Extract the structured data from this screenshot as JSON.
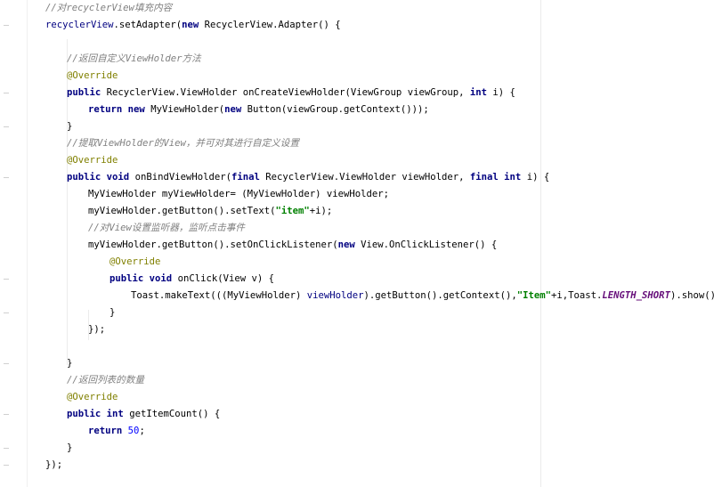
{
  "editor": {
    "lines": [
      {
        "indent": 0,
        "tokens": [
          {
            "t": "cm",
            "v": "//对recyclerView填充内容"
          }
        ]
      },
      {
        "indent": 0,
        "tokens": [
          {
            "t": "var",
            "v": "recyclerView"
          },
          {
            "t": "pl",
            "v": ".setAdapter("
          },
          {
            "t": "kw",
            "v": "new"
          },
          {
            "t": "pl",
            "v": " RecyclerView.Adapter() {"
          }
        ]
      },
      {
        "indent": 0,
        "tokens": []
      },
      {
        "indent": 1,
        "tokens": [
          {
            "t": "cm",
            "v": "//返回自定义ViewHolder方法"
          }
        ]
      },
      {
        "indent": 1,
        "tokens": [
          {
            "t": "an",
            "v": "@Override"
          }
        ]
      },
      {
        "indent": 1,
        "tokens": [
          {
            "t": "kw",
            "v": "public"
          },
          {
            "t": "pl",
            "v": " RecyclerView.ViewHolder onCreateViewHolder(ViewGroup viewGroup, "
          },
          {
            "t": "kw",
            "v": "int"
          },
          {
            "t": "pl",
            "v": " i) {"
          }
        ]
      },
      {
        "indent": 2,
        "tokens": [
          {
            "t": "kw",
            "v": "return"
          },
          {
            "t": "pl",
            "v": " "
          },
          {
            "t": "kw",
            "v": "new"
          },
          {
            "t": "pl",
            "v": " MyViewHolder("
          },
          {
            "t": "kw",
            "v": "new"
          },
          {
            "t": "pl",
            "v": " Button(viewGroup.getContext()));"
          }
        ]
      },
      {
        "indent": 1,
        "tokens": [
          {
            "t": "pl",
            "v": "}"
          }
        ]
      },
      {
        "indent": 1,
        "tokens": [
          {
            "t": "cm",
            "v": "//提取ViewHolder的View，并可对其进行自定义设置"
          }
        ]
      },
      {
        "indent": 1,
        "tokens": [
          {
            "t": "an",
            "v": "@Override"
          }
        ]
      },
      {
        "indent": 1,
        "tokens": [
          {
            "t": "kw",
            "v": "public"
          },
          {
            "t": "pl",
            "v": " "
          },
          {
            "t": "kw",
            "v": "void"
          },
          {
            "t": "pl",
            "v": " onBindViewHolder("
          },
          {
            "t": "kw",
            "v": "final"
          },
          {
            "t": "pl",
            "v": " RecyclerView.ViewHolder viewHolder, "
          },
          {
            "t": "kw",
            "v": "final"
          },
          {
            "t": "pl",
            "v": " "
          },
          {
            "t": "kw",
            "v": "int"
          },
          {
            "t": "pl",
            "v": " i) {"
          }
        ]
      },
      {
        "indent": 2,
        "tokens": [
          {
            "t": "pl",
            "v": "MyViewHolder myViewHolder= (MyViewHolder) viewHolder;"
          }
        ]
      },
      {
        "indent": 2,
        "tokens": [
          {
            "t": "pl",
            "v": "myViewHolder.getButton().setText("
          },
          {
            "t": "st",
            "v": "\"item\""
          },
          {
            "t": "pl",
            "v": "+i);"
          }
        ]
      },
      {
        "indent": 2,
        "tokens": [
          {
            "t": "cm",
            "v": "//对View设置监听器，监听点击事件"
          }
        ]
      },
      {
        "indent": 2,
        "tokens": [
          {
            "t": "pl",
            "v": "myViewHolder.getButton().setOnClickListener("
          },
          {
            "t": "kw",
            "v": "new"
          },
          {
            "t": "pl",
            "v": " View.OnClickListener() {"
          }
        ]
      },
      {
        "indent": 3,
        "tokens": [
          {
            "t": "an",
            "v": "@Override"
          }
        ]
      },
      {
        "indent": 3,
        "tokens": [
          {
            "t": "kw",
            "v": "public"
          },
          {
            "t": "pl",
            "v": " "
          },
          {
            "t": "kw",
            "v": "void"
          },
          {
            "t": "pl",
            "v": " onClick(View v) {"
          }
        ]
      },
      {
        "indent": 4,
        "tokens": [
          {
            "t": "pl",
            "v": "Toast.makeText(((MyViewHolder) "
          },
          {
            "t": "var",
            "v": "viewHolder"
          },
          {
            "t": "pl",
            "v": ").getButton().getContext(),"
          },
          {
            "t": "st",
            "v": "\"Item\""
          },
          {
            "t": "pl",
            "v": "+i,Toast."
          },
          {
            "t": "fld",
            "v": "LENGTH_SHORT"
          },
          {
            "t": "pl",
            "v": ").show();"
          }
        ]
      },
      {
        "indent": 3,
        "tokens": [
          {
            "t": "pl",
            "v": "}"
          }
        ]
      },
      {
        "indent": 2,
        "tokens": [
          {
            "t": "pl",
            "v": "});"
          }
        ]
      },
      {
        "indent": 0,
        "tokens": []
      },
      {
        "indent": 1,
        "tokens": [
          {
            "t": "pl",
            "v": "}"
          }
        ]
      },
      {
        "indent": 1,
        "tokens": [
          {
            "t": "cm",
            "v": "//返回列表的数量"
          }
        ]
      },
      {
        "indent": 1,
        "tokens": [
          {
            "t": "an",
            "v": "@Override"
          }
        ]
      },
      {
        "indent": 1,
        "tokens": [
          {
            "t": "kw",
            "v": "public"
          },
          {
            "t": "pl",
            "v": " "
          },
          {
            "t": "kw",
            "v": "int"
          },
          {
            "t": "pl",
            "v": " getItemCount() {"
          }
        ]
      },
      {
        "indent": 2,
        "tokens": [
          {
            "t": "kw",
            "v": "return"
          },
          {
            "t": "pl",
            "v": " "
          },
          {
            "t": "num",
            "v": "50"
          },
          {
            "t": "pl",
            "v": ";"
          }
        ]
      },
      {
        "indent": 1,
        "tokens": [
          {
            "t": "pl",
            "v": "}"
          }
        ]
      },
      {
        "indent": 0,
        "tokens": [
          {
            "t": "pl",
            "v": "});"
          }
        ]
      }
    ]
  }
}
